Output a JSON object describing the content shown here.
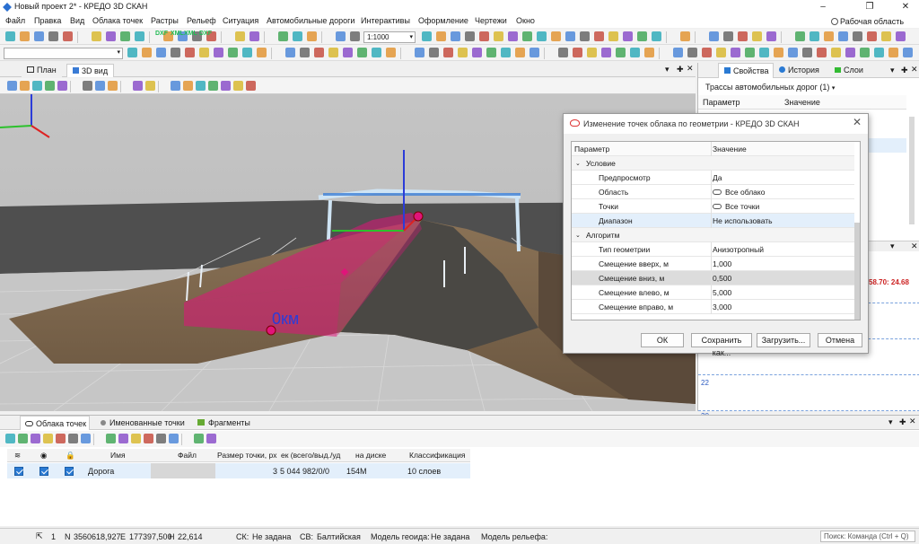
{
  "window": {
    "title": "Новый проект 2* - КРЕДО 3D СКАН",
    "workspace": "Рабочая область"
  },
  "menu": [
    "Файл",
    "Правка",
    "Вид",
    "Облака точек",
    "Растры",
    "Рельеф",
    "Ситуация",
    "Автомобильные дороги",
    "Интерактивы",
    "Оформление",
    "Чертежи",
    "Окно"
  ],
  "toolbar": {
    "scale": "1:1000",
    "dxf1": "DXF",
    "xml1": "XML",
    "xml2": "XML",
    "dxf2": "DXF"
  },
  "view_tabs": [
    {
      "label": "План"
    },
    {
      "label": "3D вид"
    }
  ],
  "viewport": {
    "km_label": "0км"
  },
  "right_panel": {
    "tabs": [
      "Свойства",
      "История",
      "Слои"
    ],
    "selector": "Трассы автомобильных дорог (1)",
    "header_param": "Параметр",
    "header_value": "Значение",
    "profile_label": "58.70: 24.68",
    "ruler_22": "22",
    "ruler_20": "20"
  },
  "dialog": {
    "title": "Изменение точек облака по геометрии - КРЕДО 3D СКАН",
    "header_param": "Параметр",
    "header_value": "Значение",
    "group1": "Условие",
    "rows1": [
      {
        "k": "Предпросмотр",
        "v": "Да"
      },
      {
        "k": "Область",
        "v": "Все облако"
      },
      {
        "k": "Точки",
        "v": "Все точки"
      },
      {
        "k": "Диапазон",
        "v": "Не использовать"
      }
    ],
    "group2": "Алгоритм",
    "rows2": [
      {
        "k": "Тип геометрии",
        "v": "Анизотропный"
      },
      {
        "k": "Смещение вверх, м",
        "v": "1,000"
      },
      {
        "k": "Смещение вниз, м",
        "v": "0,500"
      },
      {
        "k": "Смещение влево, м",
        "v": "5,000"
      },
      {
        "k": "Смещение вправо, м",
        "v": "3,000"
      }
    ],
    "buttons": {
      "ok": "ОК",
      "save": "Сохранить как...",
      "load": "Загрузить...",
      "cancel": "Отмена"
    }
  },
  "bottom": {
    "tabs": [
      "Облака точек",
      "Именованные точки",
      "Фрагменты"
    ],
    "columns": {
      "name": "Имя",
      "file": "Файл",
      "size": "Размер точки, px",
      "count": "ек (всего/выд./уд",
      "disk": "на диске",
      "class": "Классификация"
    },
    "row": {
      "name": "Дорога",
      "size": "3",
      "count": "5 044 982/0/0",
      "disk": "154M",
      "class": "10 слоев"
    }
  },
  "status": {
    "count": "1",
    "n_label": "N",
    "n": "3560618,927",
    "e_label": "E",
    "e": "177397,500",
    "h_label": "H",
    "h": "22,614",
    "sk_label": "СК:",
    "sk": "Не задана",
    "sv_label": "СВ:",
    "sv": "Балтийская",
    "geoid_label": "Модель геоида:",
    "geoid": "Не задана",
    "relief_label": "Модель рельефа:",
    "search_placeholder": "Поиск: Команда (Ctrl + Q)"
  },
  "colors": {
    "accent": "#2a7ad3",
    "pink": "#e0147a",
    "selection": "#e3effb"
  }
}
